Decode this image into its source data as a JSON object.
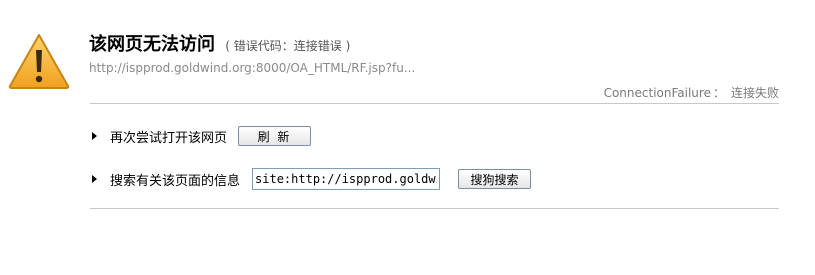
{
  "error": {
    "title": "该网页无法访问",
    "code_text": "( 错误代码：连接错误 )",
    "url": "http://ispprod.goldwind.org:8000/OA_HTML/RF.jsp?fu...",
    "failure_code": "ConnectionFailure",
    "failure_sep": "：",
    "failure_desc": "连接失败"
  },
  "actions": {
    "retry_label": "再次尝试打开该网页",
    "refresh_button": "刷 新",
    "search_label": "搜索有关该页面的信息",
    "search_value": "site:http://ispprod.goldwind",
    "search_button": "搜狗搜索"
  },
  "colors": {
    "warning_fill": "#f5a623",
    "warning_stroke": "#c07a10"
  },
  "icons": {
    "warning": "warning-triangle-icon",
    "bullet": "bullet-arrow-icon"
  }
}
